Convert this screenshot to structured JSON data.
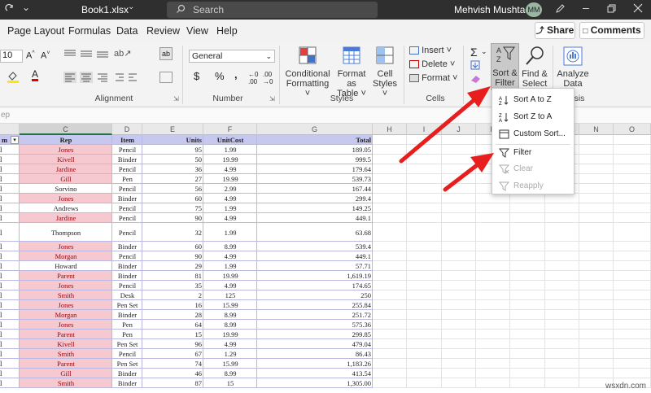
{
  "titlebar": {
    "filename": "Book1.xlsx",
    "search_placeholder": "Search",
    "user_name": "Mehvish Mushtaq",
    "avatar_initials": "MM"
  },
  "menu": [
    "Page Layout",
    "Formulas",
    "Data",
    "Review",
    "View",
    "Help"
  ],
  "share_label": "Share",
  "comments_label": "Comments",
  "ribbon": {
    "font_size": "10",
    "number_format": "General",
    "groups": {
      "alignment": "Alignment",
      "number": "Number",
      "styles": "Styles",
      "cells": "Cells",
      "analysis_partial": "sis"
    },
    "styles_buttons": [
      {
        "line1": "Conditional",
        "line2": "Formatting ˅"
      },
      {
        "line1": "Format as",
        "line2": "Table ˅"
      },
      {
        "line1": "Cell",
        "line2": "Styles ˅"
      }
    ],
    "cells_buttons": [
      "Insert ˅",
      "Delete ˅",
      "Format ˅"
    ],
    "sort_filter": {
      "line1": "Sort &",
      "line2": "Filter ˅"
    },
    "find_select": {
      "line1": "Find &",
      "line2": "Select ˅"
    },
    "analyze": {
      "line1": "Analyze",
      "line2": "Data"
    }
  },
  "formula_name": "ep",
  "dropdown": {
    "items": [
      {
        "label": "Sort A to Z",
        "enabled": true
      },
      {
        "label": "Sort Z to A",
        "enabled": true
      },
      {
        "label": "Custom Sort...",
        "enabled": true
      },
      {
        "label": "Filter",
        "enabled": true
      },
      {
        "label": "Clear",
        "enabled": false
      },
      {
        "label": "Reapply",
        "enabled": false
      }
    ]
  },
  "columns": [
    "C",
    "D",
    "E",
    "F",
    "G",
    "H",
    "I",
    "J",
    "K",
    "L",
    "M",
    "N",
    "O"
  ],
  "headers": {
    "b": "m",
    "c": "Rep",
    "d": "Item",
    "e": "Units",
    "f": "UnitCost",
    "g": "Total"
  },
  "rows": [
    {
      "rep": "Jones",
      "item": "Pencil",
      "units": "95",
      "cost": "1.99",
      "total": "189.05",
      "pink": true
    },
    {
      "rep": "Kivell",
      "item": "Binder",
      "units": "50",
      "cost": "19.99",
      "total": "999.5",
      "pink": true
    },
    {
      "rep": "Jardine",
      "item": "Pencil",
      "units": "36",
      "cost": "4.99",
      "total": "179.64",
      "pink": true
    },
    {
      "rep": "Gill",
      "item": "Pen",
      "units": "27",
      "cost": "19.99",
      "total": "539.73",
      "pink": true
    },
    {
      "rep": "Sorvino",
      "item": "Pencil",
      "units": "56",
      "cost": "2.99",
      "total": "167.44",
      "pink": false
    },
    {
      "rep": "Jones",
      "item": "Binder",
      "units": "60",
      "cost": "4.99",
      "total": "299.4",
      "pink": true
    },
    {
      "rep": "Andrews",
      "item": "Pencil",
      "units": "75",
      "cost": "1.99",
      "total": "149.25",
      "pink": false
    },
    {
      "rep": "Jardine",
      "item": "Pencil",
      "units": "90",
      "cost": "4.99",
      "total": "449.1",
      "pink": true
    },
    {
      "rep": "Thompson",
      "item": "Pencil",
      "units": "32",
      "cost": "1.99",
      "total": "63.68",
      "pink": false,
      "tall": true
    },
    {
      "rep": "Jones",
      "item": "Binder",
      "units": "60",
      "cost": "8.99",
      "total": "539.4",
      "pink": true
    },
    {
      "rep": "Morgan",
      "item": "Pencil",
      "units": "90",
      "cost": "4.99",
      "total": "449.1",
      "pink": true
    },
    {
      "rep": "Howard",
      "item": "Binder",
      "units": "29",
      "cost": "1.99",
      "total": "57.71",
      "pink": false
    },
    {
      "rep": "Parent",
      "item": "Binder",
      "units": "81",
      "cost": "19.99",
      "total": "1,619.19",
      "pink": true
    },
    {
      "rep": "Jones",
      "item": "Pencil",
      "units": "35",
      "cost": "4.99",
      "total": "174.65",
      "pink": true
    },
    {
      "rep": "Smith",
      "item": "Desk",
      "units": "2",
      "cost": "125",
      "total": "250",
      "pink": true
    },
    {
      "rep": "Jones",
      "item": "Pen Set",
      "units": "16",
      "cost": "15.99",
      "total": "255.84",
      "pink": true
    },
    {
      "rep": "Morgan",
      "item": "Binder",
      "units": "28",
      "cost": "8.99",
      "total": "251.72",
      "pink": true
    },
    {
      "rep": "Jones",
      "item": "Pen",
      "units": "64",
      "cost": "8.99",
      "total": "575.36",
      "pink": true
    },
    {
      "rep": "Parent",
      "item": "Pen",
      "units": "15",
      "cost": "19.99",
      "total": "299.85",
      "pink": true
    },
    {
      "rep": "Kivell",
      "item": "Pen Set",
      "units": "96",
      "cost": "4.99",
      "total": "479.04",
      "pink": true
    },
    {
      "rep": "Smith",
      "item": "Pencil",
      "units": "67",
      "cost": "1.29",
      "total": "86.43",
      "pink": true
    },
    {
      "rep": "Parent",
      "item": "Pen Set",
      "units": "74",
      "cost": "15.99",
      "total": "1,183.26",
      "pink": true
    },
    {
      "rep": "Gill",
      "item": "Binder",
      "units": "46",
      "cost": "8.99",
      "total": "413.54",
      "pink": true
    },
    {
      "rep": "Smith",
      "item": "Binder",
      "units": "87",
      "cost": "15",
      "total": "1,305.00",
      "pink": true
    }
  ],
  "colors": {
    "pink": "#f6c8d0",
    "header_blue": "#c6c8f0",
    "arrow": "#e81d1d",
    "red_text": "#9c0006"
  },
  "watermark": "wsxdn.com"
}
